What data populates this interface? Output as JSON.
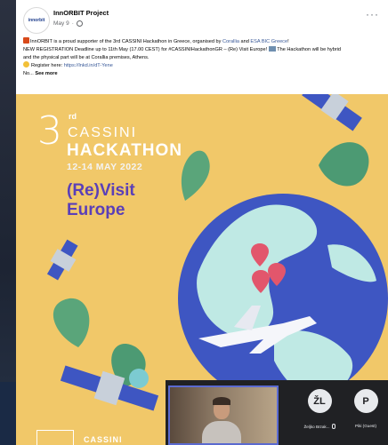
{
  "post": {
    "page_name": "InnORBIT Project",
    "date": "May 9",
    "avatar_text": "innorbit",
    "more_label": "···",
    "line1_a": "InnORBIT is a proud supporter of the 3rd CASSINI Hackathon in Greece, organised by ",
    "line1_link1": "Corallia",
    "line1_and": " and ",
    "line1_link2": "ESA BIC Greece",
    "line1_end": "!",
    "line2": "NEW REGISTRATION Deadline up to 11th May (17.00 CEST) for #CASSINIHackathonGR – (Re) Visit Europe! ",
    "line2_end": " The Hackathon will be hybrid",
    "line3": "and the physical part will be at Corallia premises, Athens.",
    "line4_a": "Register here: ",
    "line4_link": "https://lnkd.in/dT-Yene",
    "line5_a": "No... ",
    "see_more": "See more"
  },
  "poster": {
    "ordinal": "3",
    "ordinal_suffix": "rd",
    "cassini": "CASSINI",
    "hackathon": "HACKATHON",
    "dates": "12-14 MAY 2022",
    "revisit": "(Re)Visit",
    "europe": "Europe",
    "footer": "CASSINI"
  },
  "call": {
    "participants": [
      {
        "initials": "ŽL",
        "name": "Željko Brzak..."
      },
      {
        "initials": "P",
        "name": "Piki (Guest)"
      }
    ]
  },
  "colors": {
    "poster_bg": "#f1c869",
    "ocean": "#3e56c2",
    "land": "#bfe9e4",
    "text_purple": "#5a3fb8",
    "call_bg": "#202124",
    "video_border": "#5b6ad0"
  }
}
